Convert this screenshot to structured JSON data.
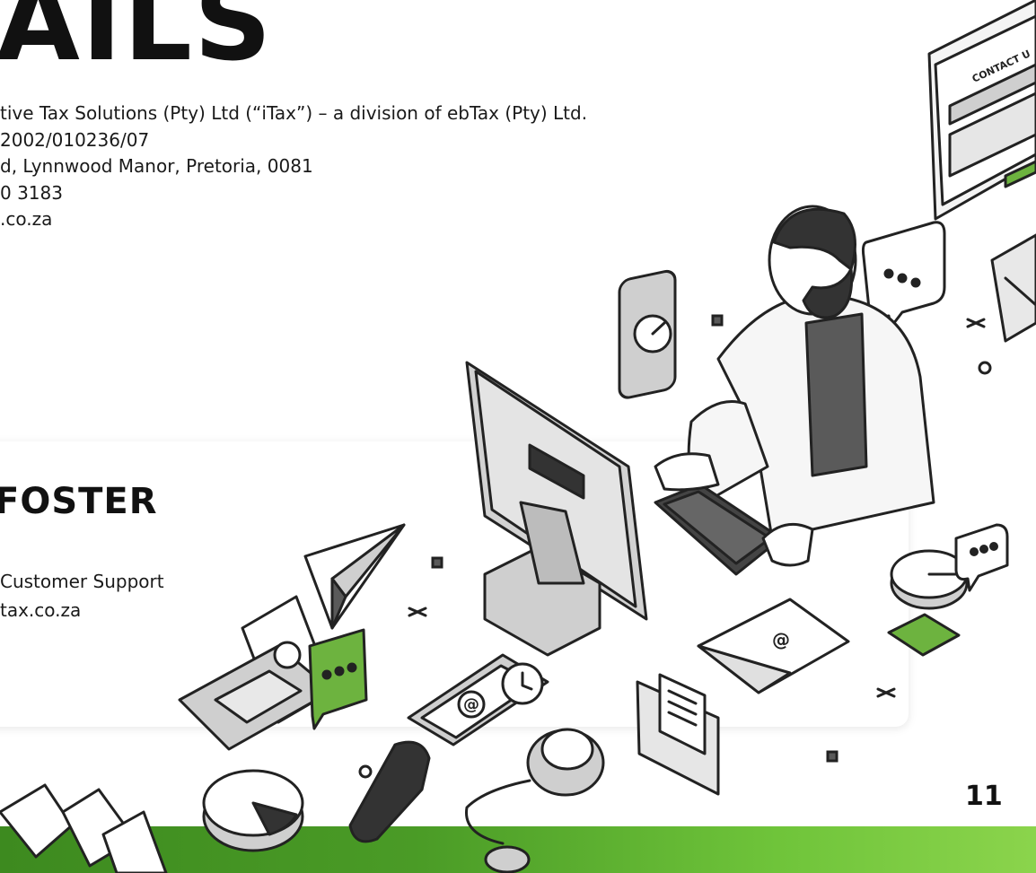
{
  "page": {
    "heading": "AILS",
    "page_number": "11"
  },
  "company_details": [
    "tive Tax Solutions (Pty) Ltd (“iTax”)  – a division of ebTax (Pty) Ltd.",
    "2002/010236/07",
    "d, Lynnwood Manor, Pretoria, 0081",
    "0 3183",
    ".co.za"
  ],
  "contact_card": {
    "name": "FOSTER",
    "role": "Customer Support",
    "email": "tax.co.za"
  },
  "illustration": {
    "form_title": "CONTACT U",
    "icons": [
      "contact-form-icon",
      "chat-bubble-icon",
      "mobile-phone-icon",
      "envelope-icon",
      "paper-plane-icon",
      "laptop-icon",
      "email-at-icon",
      "clock-icon",
      "telephone-handset-icon",
      "computer-mouse-icon",
      "pie-chart-icon",
      "smiley-icon",
      "monitor-icon",
      "keyboard-icon"
    ],
    "colors": {
      "accent_green": "#6db33f",
      "dark_gray": "#5a5a5a",
      "light_gray": "#cfcfcf",
      "outline": "#222222"
    }
  }
}
